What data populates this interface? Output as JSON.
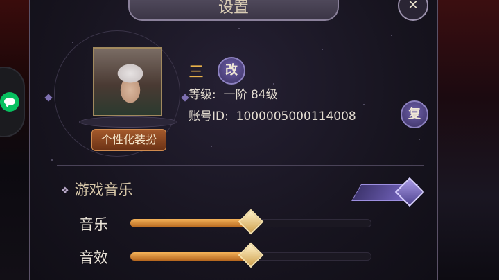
{
  "header": {
    "title": "设置"
  },
  "profile": {
    "name": "三",
    "rename_label": "改",
    "level_label": "等级:",
    "level_value": "一阶 84级",
    "account_label": "账号ID:",
    "account_value": "1000005000114008",
    "copy_label": "复",
    "skin_button": "个性化装扮"
  },
  "section": {
    "title": "游戏音乐",
    "toggle_on": true
  },
  "sliders": [
    {
      "label": "音乐",
      "value": 0.5
    },
    {
      "label": "音效",
      "value": 0.5
    }
  ],
  "colors": {
    "accent": "#e9b24a",
    "slider_fill": "#f5b35a",
    "toggle": "#7666c2"
  }
}
